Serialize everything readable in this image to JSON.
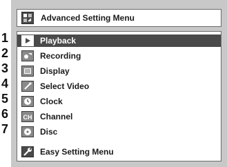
{
  "header": {
    "title": "Advanced Setting Menu",
    "icon": "settings-icon"
  },
  "menu": {
    "items": [
      {
        "number": "1",
        "label": "Playback",
        "icon": "play-icon",
        "selected": true
      },
      {
        "number": "2",
        "label": "Recording",
        "icon": "recording-icon",
        "selected": false
      },
      {
        "number": "3",
        "label": "Display",
        "icon": "display-icon",
        "selected": false
      },
      {
        "number": "4",
        "label": "Select Video",
        "icon": "video-icon",
        "selected": false
      },
      {
        "number": "5",
        "label": "Clock",
        "icon": "clock-icon",
        "selected": false
      },
      {
        "number": "6",
        "label": "Channel",
        "icon": "channel-icon",
        "selected": false
      },
      {
        "number": "7",
        "label": "Disc",
        "icon": "disc-icon",
        "selected": false
      }
    ],
    "channel_icon_text": "CH"
  },
  "footer": {
    "label": "Easy Setting Menu",
    "icon": "wrench-icon"
  },
  "colors": {
    "panel_bg": "#c8c8c8",
    "selected_bg": "#4a4a4a",
    "text": "#1a1a1a"
  }
}
